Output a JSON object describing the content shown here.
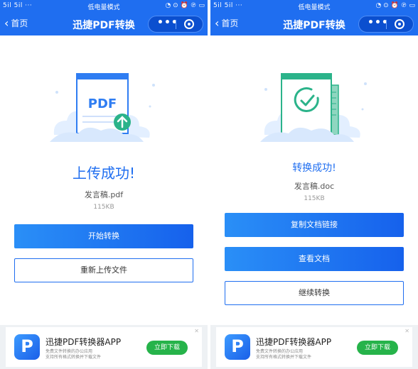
{
  "colors": {
    "brand_blue": "#1f6ef0",
    "download_green": "#26b34a",
    "check_teal": "#2bb38a"
  },
  "left": {
    "status": {
      "signal": "5il 5il ···",
      "mode": "低电量模式",
      "icons": "◔ ⊙ ⏰ ℗ ▭"
    },
    "nav": {
      "back_label": "首页",
      "title": "迅捷PDF转换"
    },
    "illustration": {
      "doc_label": "PDF",
      "badge_icon": "upload-arrow-icon"
    },
    "success_text": "上传成功!",
    "file_name": "发言稿.pdf",
    "file_size": "115KB",
    "buttons": {
      "start_convert": "开始转换",
      "reupload": "重新上传文件"
    },
    "ad": {
      "app_name": "迅捷PDF转换器APP",
      "desc1": "免费文件转换的办公应用",
      "desc2": "支持所有格式转换并下载文件",
      "download": "立即下载",
      "close": "✕"
    }
  },
  "right": {
    "status": {
      "signal": "5il 5il ···",
      "mode": "低电量模式",
      "icons": "◔ ⊙ ⏰ ℗ ▭"
    },
    "nav": {
      "back_label": "首页",
      "title": "迅捷PDF转换"
    },
    "illustration": {
      "badge_icon": "clock-check-icon"
    },
    "success_text": "转换成功!",
    "file_name": "发言稿.doc",
    "file_size": "115KB",
    "buttons": {
      "copy_link": "复制文档链接",
      "view_doc": "查看文档",
      "continue": "继续转换"
    },
    "ad": {
      "app_name": "迅捷PDF转换器APP",
      "desc1": "免费文件转换的办公应用",
      "desc2": "支持所有格式转换并下载文件",
      "download": "立即下载",
      "close": "✕"
    }
  }
}
